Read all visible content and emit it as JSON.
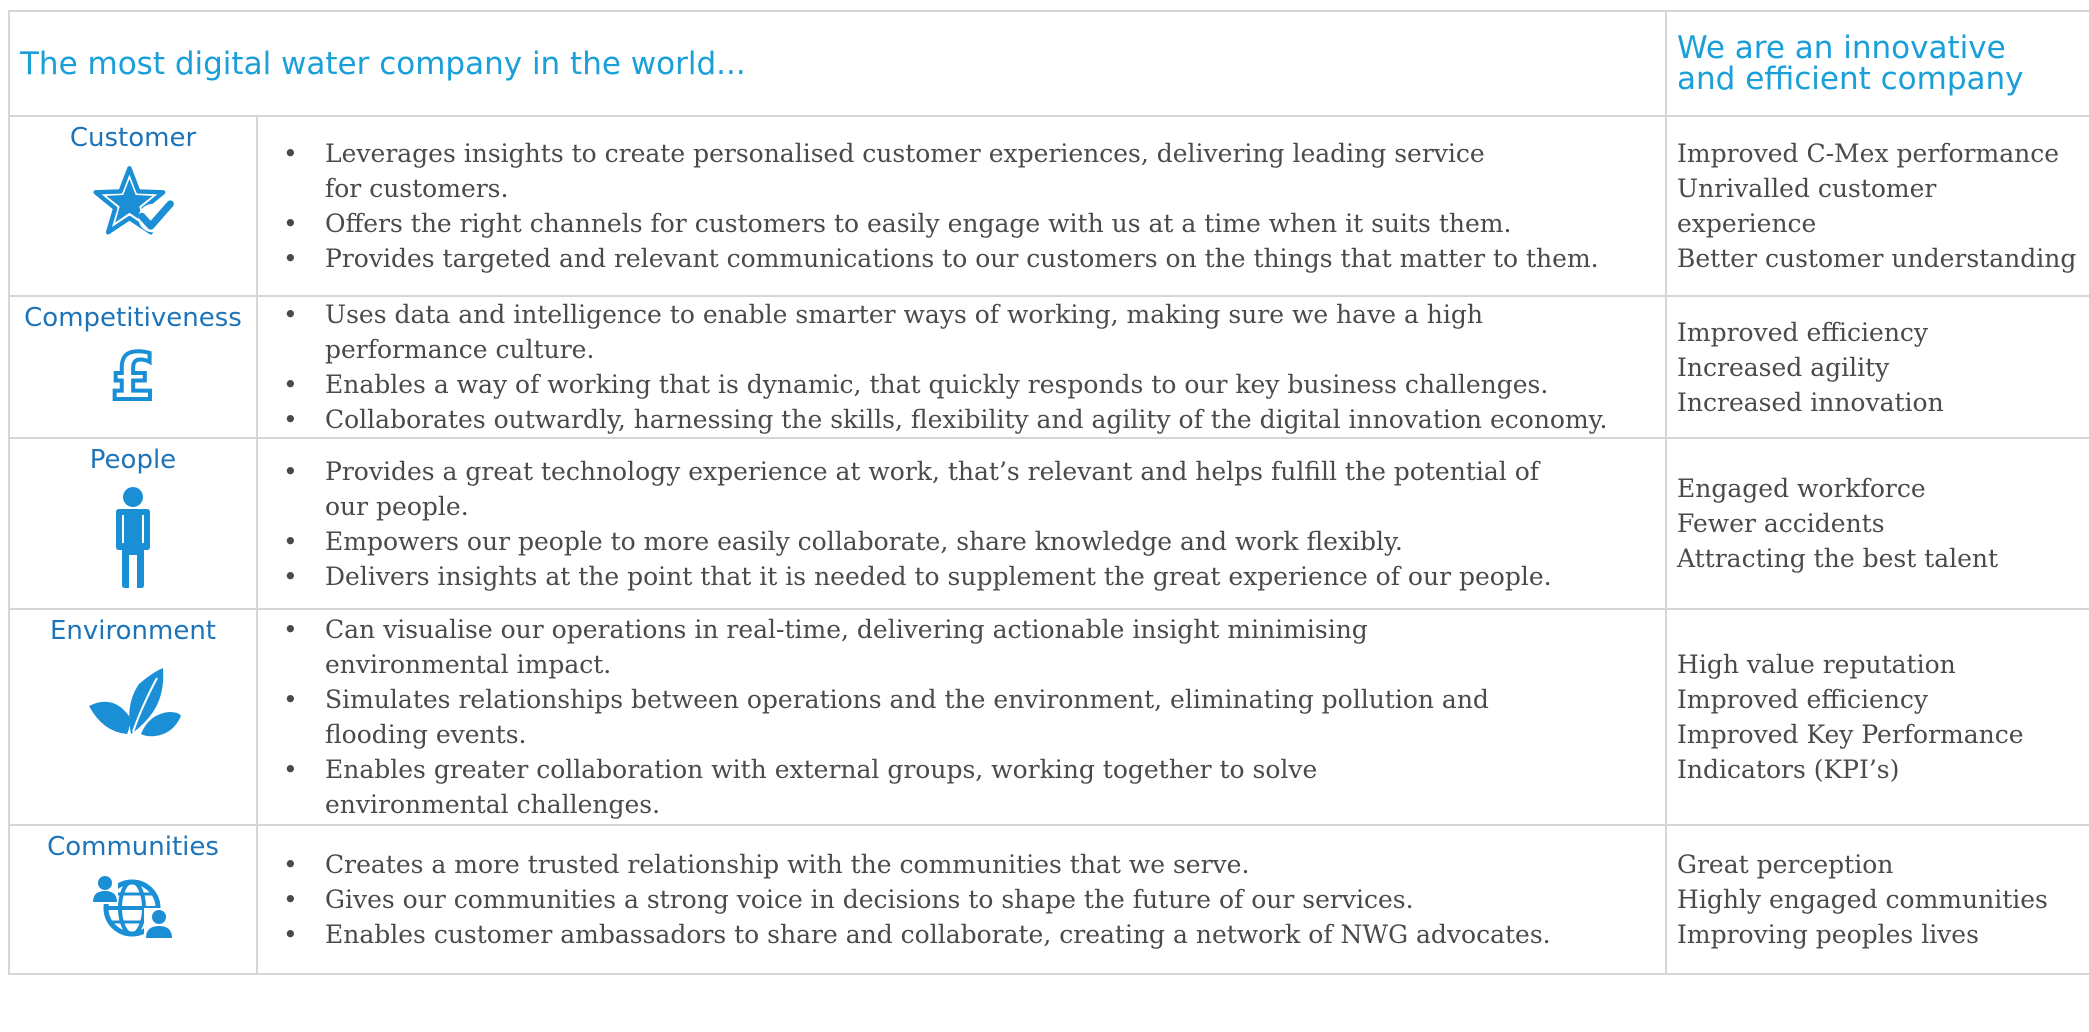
{
  "header": {
    "left_title": "The most digital water company in the world...",
    "right_title_line1": "We are an innovative",
    "right_title_line2": "and efficient company"
  },
  "rows": [
    {
      "category": "Customer",
      "icon": "star-check-icon",
      "bullets": [
        "Leverages insights to create personalised customer experiences, delivering leading service",
        "for customers.",
        "Offers the right channels for customers to easily engage with us at a time when it suits them.",
        "Provides targeted and relevant communications to our customers on the things that matter to them."
      ],
      "outcomes": [
        "Improved C-Mex performance",
        "Unrivalled customer",
        "experience",
        "Better customer understanding"
      ]
    },
    {
      "category": "Competitiveness",
      "icon": "pound-icon",
      "bullets": [
        "Uses data and intelligence to enable smarter ways of working, making sure we have a high",
        "performance culture.",
        "Enables a way of working that is dynamic, that quickly responds to our key business challenges.",
        "Collaborates outwardly, harnessing the skills, flexibility and agility of the digital innovation economy."
      ],
      "outcomes": [
        "Improved efficiency",
        "Increased agility",
        "Increased innovation"
      ]
    },
    {
      "category": "People",
      "icon": "person-icon",
      "bullets": [
        "Provides a great technology experience at work, that’s relevant and helps fulfill the potential of",
        "our people.",
        "Empowers our people to more easily collaborate, share knowledge and work flexibly.",
        "Delivers insights at the point that it is needed to supplement the great experience of our people."
      ],
      "outcomes": [
        "Engaged workforce",
        "Fewer accidents",
        "Attracting the best talent"
      ]
    },
    {
      "category": "Environment",
      "icon": "leaves-icon",
      "bullets": [
        "Can visualise our operations in real-time, delivering actionable insight minimising",
        "environmental impact.",
        "Simulates relationships between operations and the environment, eliminating pollution and",
        "flooding events.",
        "Enables greater collaboration with external groups, working together to solve",
        "environmental challenges."
      ],
      "outcomes": [
        "High value reputation",
        "Improved efficiency",
        "Improved Key Performance",
        "Indicators (KPI’s)"
      ]
    },
    {
      "category": "Communities",
      "icon": "globe-people-icon",
      "bullets": [
        "Creates a more trusted relationship with the communities that we serve.",
        "Gives our communities a strong voice in decisions to shape the future of our services.",
        "Enables customer ambassadors to share and collaborate, creating a network of NWG advocates."
      ],
      "outcomes": [
        "Great perception",
        "Highly engaged communities",
        "Improving peoples lives"
      ]
    }
  ],
  "colors": {
    "heading_blue": "#1a9fd9",
    "category_blue": "#1e74b8",
    "icon_blue": "#1a8fd6",
    "text_gray": "#4a4a4a",
    "border_gray": "#d6d6d6"
  }
}
